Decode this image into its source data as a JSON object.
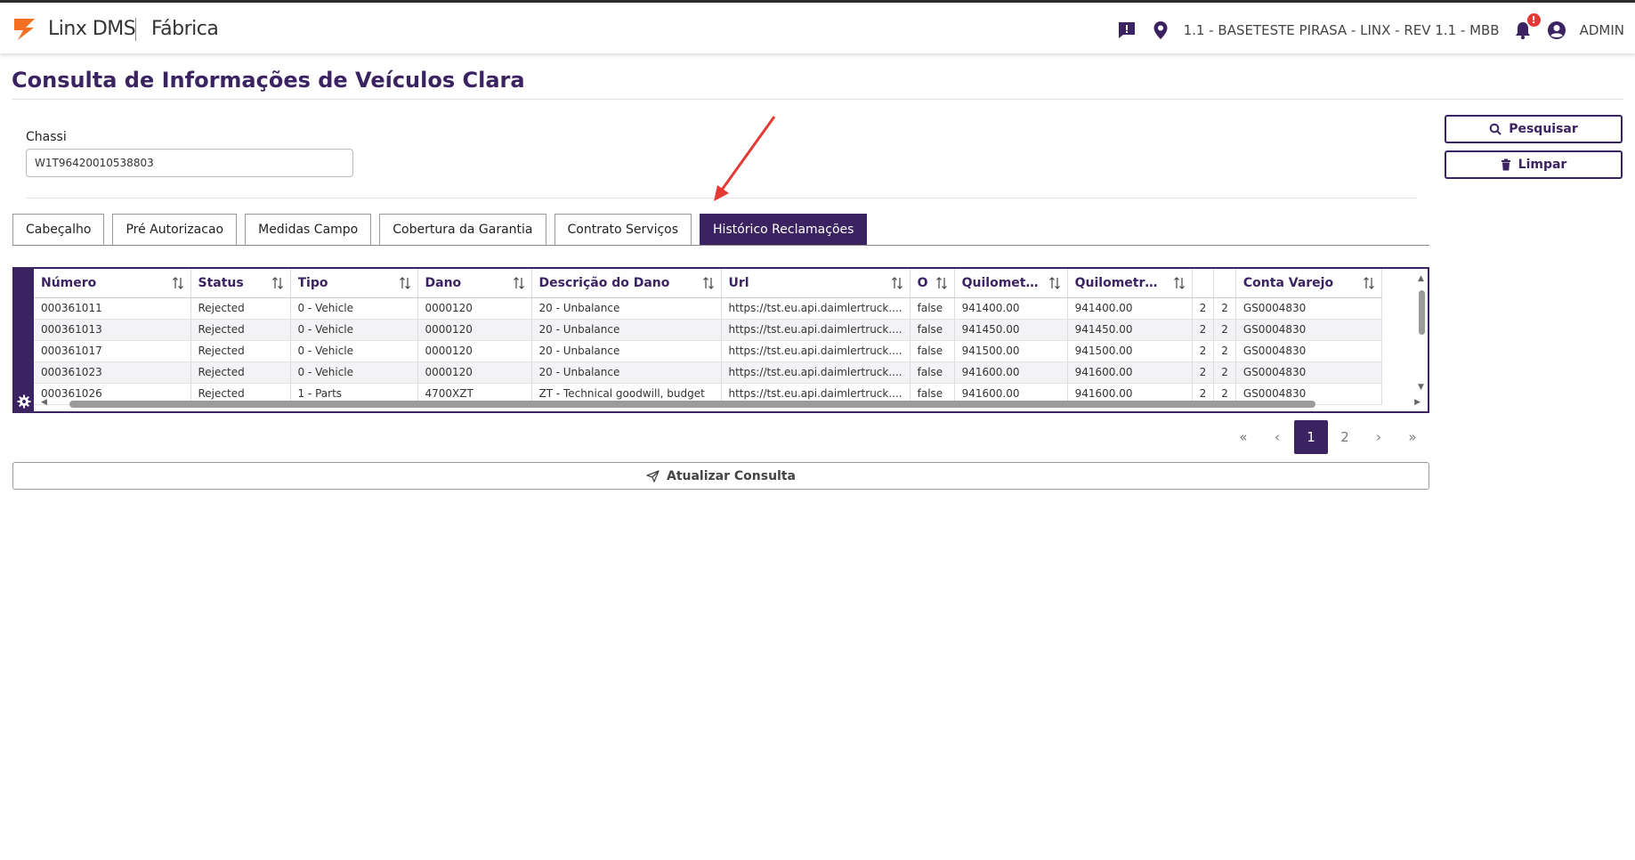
{
  "header": {
    "brand": "Linx DMS",
    "module": "Fábrica",
    "location": "1.1 - BASETESTE PIRASA - LINX - REV 1.1 - MBB",
    "notification_count": "!",
    "user": "ADMIN"
  },
  "page": {
    "title": "Consulta de Informações de Veículos Clara"
  },
  "form": {
    "chassi_label": "Chassi",
    "chassi_value": "W1T96420010538803",
    "search_label": "Pesquisar",
    "clear_label": "Limpar"
  },
  "tabs": [
    {
      "label": "Cabeçalho",
      "active": false
    },
    {
      "label": "Pré Autorizacao",
      "active": false
    },
    {
      "label": "Medidas Campo",
      "active": false
    },
    {
      "label": "Cobertura da Garantia",
      "active": false
    },
    {
      "label": "Contrato Serviços",
      "active": false
    },
    {
      "label": "Histórico Reclamações",
      "active": true
    }
  ],
  "grid": {
    "columns": [
      "Número",
      "Status",
      "Tipo",
      "Dano",
      "Descrição do Dano",
      "Url",
      "O",
      "Quilometra...",
      "Quilometrag...",
      "",
      "",
      "Conta Varejo"
    ],
    "rows": [
      [
        "000361011",
        "Rejected",
        "0 - Vehicle",
        "0000120",
        "20 - Unbalance",
        "https://tst.eu.api.daimlertruck....",
        "false",
        "941400.00",
        "941400.00",
        "2",
        "2",
        "GS0004830"
      ],
      [
        "000361013",
        "Rejected",
        "0 - Vehicle",
        "0000120",
        "20 - Unbalance",
        "https://tst.eu.api.daimlertruck....",
        "false",
        "941450.00",
        "941450.00",
        "2",
        "2",
        "GS0004830"
      ],
      [
        "000361017",
        "Rejected",
        "0 - Vehicle",
        "0000120",
        "20 - Unbalance",
        "https://tst.eu.api.daimlertruck....",
        "false",
        "941500.00",
        "941500.00",
        "2",
        "2",
        "GS0004830"
      ],
      [
        "000361023",
        "Rejected",
        "0 - Vehicle",
        "0000120",
        "20 - Unbalance",
        "https://tst.eu.api.daimlertruck....",
        "false",
        "941600.00",
        "941600.00",
        "2",
        "2",
        "GS0004830"
      ],
      [
        "000361026",
        "Rejected",
        "1 - Parts",
        "4700XZT",
        "ZT - Technical goodwill, budget",
        "https://tst.eu.api.daimlertruck....",
        "false",
        "941600.00",
        "941600.00",
        "2",
        "2",
        "GS0004830"
      ]
    ]
  },
  "pagination": {
    "first": "«",
    "prev": "‹",
    "pages": [
      "1",
      "2"
    ],
    "current": "1",
    "next": "›",
    "last": "»"
  },
  "actions": {
    "update_label": "Atualizar Consulta"
  },
  "colors": {
    "primary": "#3b2362",
    "logo_orange": "#f36f21",
    "annotation_red": "#e53935"
  },
  "icons": {
    "logo": "linx-logo-icon",
    "chat": "chat-alert-icon",
    "location": "map-pin-icon",
    "bell": "bell-icon",
    "user": "user-circle-icon",
    "search": "search-icon",
    "trash": "trash-icon",
    "sort": "sort-icon",
    "gear": "gear-icon",
    "send": "send-icon"
  }
}
